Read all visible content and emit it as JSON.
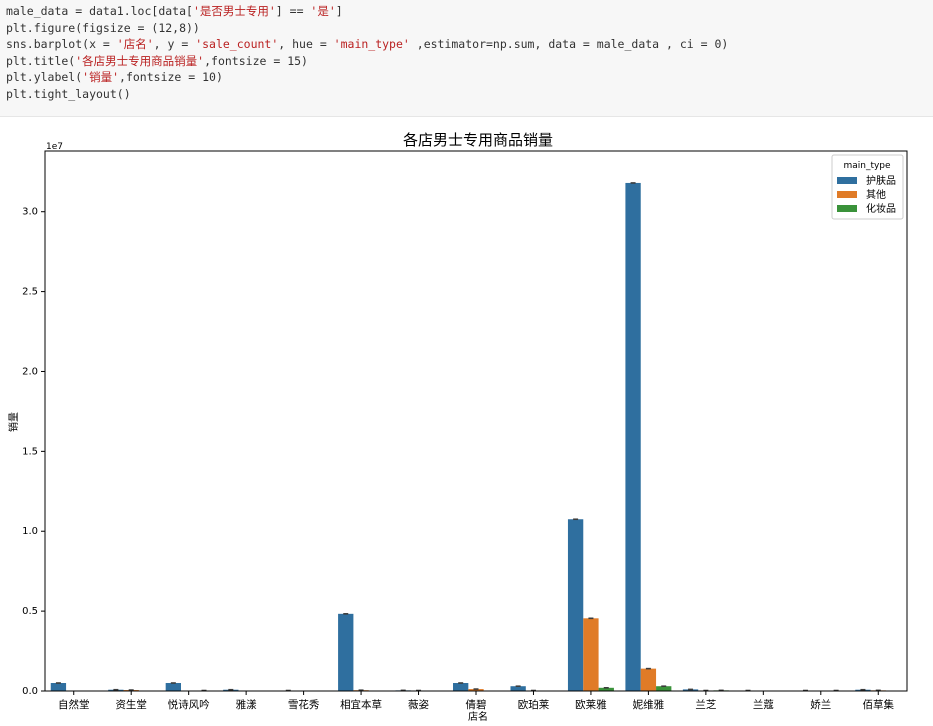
{
  "code_cell": {
    "lines": [
      [
        [
          "male_data = data1.loc[data[",
          ""
        ],
        [
          "'是否男士专用'",
          "str"
        ],
        [
          "] == ",
          ""
        ],
        [
          "'是'",
          "str"
        ],
        [
          "]",
          ""
        ]
      ],
      [
        [
          "plt.figure(figsize = (12,8))",
          ""
        ]
      ],
      [
        [
          "sns.barplot(x = ",
          ""
        ],
        [
          "'店名'",
          "str"
        ],
        [
          ", y = ",
          ""
        ],
        [
          "'sale_count'",
          "str"
        ],
        [
          ", hue = ",
          ""
        ],
        [
          "'main_type'",
          "str"
        ],
        [
          " ,estimator=np.sum, data = male_data , ci = 0)",
          ""
        ]
      ],
      [
        [
          "plt.title(",
          ""
        ],
        [
          "'各店男士专用商品销量'",
          "str"
        ],
        [
          ",fontsize = 15)",
          ""
        ]
      ],
      [
        [
          "plt.ylabel(",
          ""
        ],
        [
          "'销量'",
          "str"
        ],
        [
          ",fontsize = 10)",
          ""
        ]
      ],
      [
        [
          "plt.tight_layout()",
          ""
        ]
      ]
    ]
  },
  "chart_data": {
    "type": "bar",
    "title": "各店男士专用商品销量",
    "xlabel": "店名",
    "ylabel": "销量",
    "y_offset_label": "1e7",
    "ylim": [
      0,
      3.38
    ],
    "yticks": [
      0.0,
      0.5,
      1.0,
      1.5,
      2.0,
      2.5,
      3.0
    ],
    "ytick_labels": [
      "0.0",
      "0.5",
      "1.0",
      "1.5",
      "2.0",
      "2.5",
      "3.0"
    ],
    "categories": [
      "自然堂",
      "资生堂",
      "悦诗风吟",
      "雅漾",
      "雪花秀",
      "相宜本草",
      "薇姿",
      "倩碧",
      "欧珀莱",
      "欧莱雅",
      "妮维雅",
      "兰芝",
      "兰蔻",
      "娇兰",
      "佰草集"
    ],
    "legend": {
      "title": "main_type",
      "position": "top-right"
    },
    "series": [
      {
        "name": "护肤品",
        "color": "#2f6f9f",
        "values": [
          0.05,
          0.008,
          0.05,
          0.008,
          0.003,
          0.483,
          0.004,
          0.05,
          0.03,
          1.075,
          3.18,
          0.01,
          0.003,
          0.003,
          0.008
        ]
      },
      {
        "name": "其他",
        "color": "#e07b27",
        "values": [
          0,
          0.006,
          0,
          0,
          0,
          0.005,
          0.003,
          0.012,
          0.003,
          0.455,
          0.14,
          0.003,
          0,
          0,
          0.004
        ]
      },
      {
        "name": "化妆品",
        "color": "#3a923a",
        "values": [
          0,
          0,
          0.003,
          0,
          0,
          0,
          0,
          0,
          0,
          0.02,
          0.03,
          0.004,
          0,
          0.003,
          0
        ]
      }
    ],
    "grid": false
  }
}
